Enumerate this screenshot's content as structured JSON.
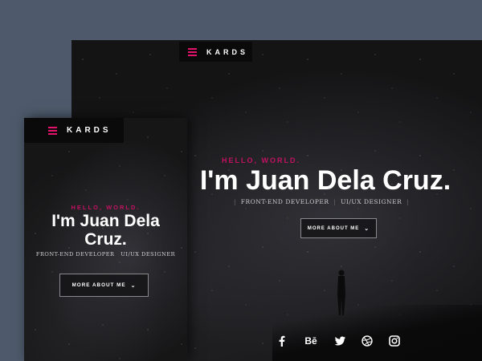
{
  "brand": "KARDS",
  "desktop": {
    "hello": "HELLO, WORLD.",
    "title": "I'm Juan Dela Cruz.",
    "roles": [
      "FRONT-END DEVELOPER",
      "UI/UX DESIGNER"
    ],
    "button_label": "MORE ABOUT ME",
    "socials": [
      "facebook-icon",
      "behance-icon",
      "twitter-icon",
      "dribbble-icon",
      "instagram-icon"
    ],
    "behance_text": "Bē"
  },
  "mobile": {
    "hello": "HELLO, WORLD.",
    "title_line1": "I'm Juan Dela",
    "title_line2": "Cruz.",
    "roles": [
      "FRONT-END DEVELOPER",
      "UI/UX DESIGNER"
    ],
    "button_label": "MORE ABOUT ME"
  },
  "colors": {
    "accent": "#e3126a",
    "background": "#4e5a6b",
    "screen": "#141415"
  }
}
